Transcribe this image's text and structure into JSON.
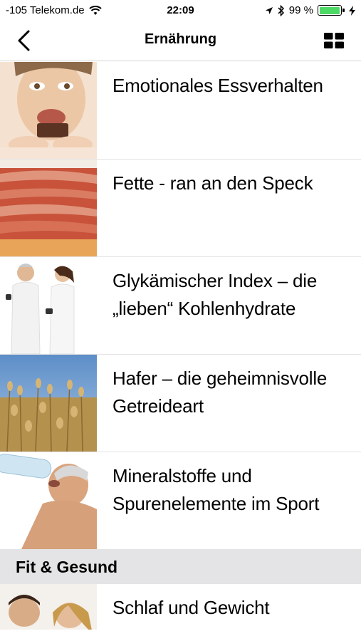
{
  "status_bar": {
    "carrier": "-105 Telekom.de",
    "time": "22:09",
    "battery_percent": "99 %",
    "battery_level": 0.99,
    "icons": [
      "wifi-icon",
      "location-arrow-icon",
      "bluetooth-icon",
      "battery-icon",
      "charging-bolt-icon"
    ]
  },
  "nav": {
    "title": "Ernährung",
    "back_icon": "chevron-left-icon",
    "grid_icon": "grid-view-icon"
  },
  "articles": [
    {
      "title": "Emotionales Essverhalten",
      "image": "woman-eating-chocolate"
    },
    {
      "title": "Fette - ran an den Speck",
      "image": "bacon-slices"
    },
    {
      "title": "Glykämischer Index – die „lieben“ Kohlenhydrate",
      "image": "couple-with-dumbbells"
    },
    {
      "title": "Hafer – die geheimnisvolle Getreideart",
      "image": "oat-field"
    },
    {
      "title": "Mineralstoffe und Spurenelemente im Sport",
      "image": "man-drinking-water"
    }
  ],
  "section": {
    "title": "Fit & Gesund"
  },
  "section_articles": [
    {
      "title": "Schlaf und Gewicht",
      "image": "sleeping-couple"
    }
  ],
  "colors": {
    "battery_green": "#4cd964",
    "section_bg": "#e4e4e6",
    "separator": "#e3e3e3"
  }
}
